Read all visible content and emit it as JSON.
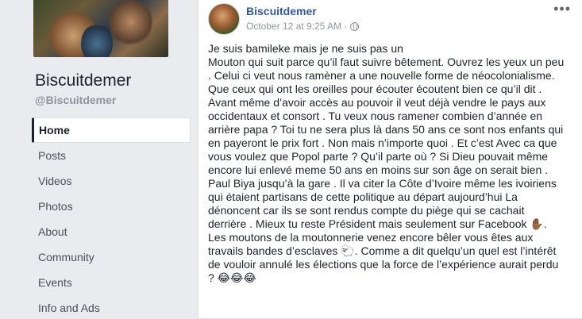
{
  "sidebar": {
    "page_name": "Biscuitdemer",
    "handle": "@Biscuitdemer",
    "items": [
      {
        "label": "Home"
      },
      {
        "label": "Posts"
      },
      {
        "label": "Videos"
      },
      {
        "label": "Photos"
      },
      {
        "label": "About"
      },
      {
        "label": "Community"
      },
      {
        "label": "Events"
      },
      {
        "label": "Info and Ads"
      }
    ]
  },
  "post": {
    "author": "Biscuitdemer",
    "timestamp": "October 12 at 9:25 AM · ",
    "more_glyph": "•••",
    "lines": [
      "Je suis bamileke mais je ne suis pas un",
      "Mouton qui suit parce qu’il faut suivre bêtement. Ouvrez les yeux un peu",
      ". Celui ci veut nous ramèner a une nouvelle forme de néocolonialisme.",
      "Que ceux qui ont les oreilles pour écouter écoutent bien ce qu’il dit .",
      "Avant même d’avoir accès au pouvoir il veut déjà vendre le pays aux",
      "occidentaux et consort . Tu veux nous ramener combien d’année en",
      "arrière papa ? Toi tu ne sera plus là dans 50 ans ce sont nos enfants qui",
      "en payeront le prix fort . Non mais n’importe quoi . Et c’est Avec ca que",
      "vous voulez que Popol parte ? Qu’il parte où ? Si Dieu pouvait même",
      "encore lui enlevé meme 50 ans en moins sur son âge on serait bien .",
      "Paul Biya jusqu’à la gare . Il va citer la Côte d’Ivoire même les ivoiriens",
      "qui étaient partisans de cette politique au départ aujourd’hui La",
      "dénoncent car ils se sont rendus compte du piège qui se cachait",
      "derrière . Mieux tu reste Président mais seulement sur Facebook ✋🏾.",
      "Les moutons de la moutonnerie venez encore bêler vous êtes aux",
      "travails bandes d’esclaves 🐑. Comme a dit quelqu’un quel est l’intérêt",
      "de vouloir annulé les élections que la force de l’expérience aurait perdu",
      "? 😂😂😂"
    ]
  }
}
